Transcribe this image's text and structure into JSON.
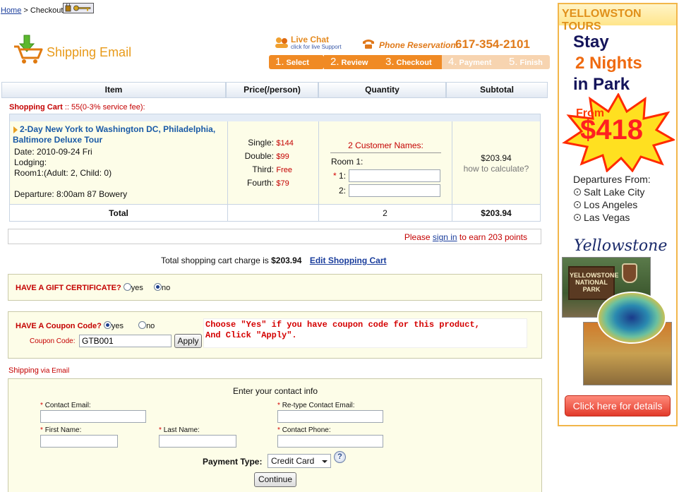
{
  "breadcrumb": {
    "home": "Home",
    "sep": ">",
    "current": "Checkout"
  },
  "header": {
    "logo_text": "Shipping Email",
    "live_chat": "Live Chat",
    "live_chat_sub": "click for live Support",
    "phone_label": "Phone Reservation:",
    "phone_number": "617-354-2101",
    "steps": [
      {
        "num": "1.",
        "label": "Select"
      },
      {
        "num": "2.",
        "label": "Review"
      },
      {
        "num": "3.",
        "label": "Checkout"
      },
      {
        "num": "4.",
        "label": "Payment"
      },
      {
        "num": "5.",
        "label": "Finish"
      }
    ]
  },
  "table": {
    "headers": [
      "Item",
      "Price(/person)",
      "Quantity",
      "Subtotal"
    ],
    "cart_label": "Shopping Cart",
    "cart_fee": " :: 55(0-3% service fee):",
    "tour_title": "2-Day New York to Washington DC, Philadelphia, Baltimore Deluxe Tour",
    "date": "Date: 2010-09-24 Fri",
    "lodging": "Lodging:",
    "room": "Room1:(Adult: 2, Child: 0)",
    "departure": "Departure: 8:00am 87 Bowery",
    "prices": [
      {
        "label": "Single:",
        "value": "$144"
      },
      {
        "label": "Double:",
        "value": "$99"
      },
      {
        "label": "Third:",
        "value": "Free"
      },
      {
        "label": "Fourth:",
        "value": "$79"
      }
    ],
    "customer_names": "2 Customer Names:",
    "room1": "Room 1:",
    "name1_label": "1:",
    "name2_label": "2:",
    "subtotal": "$203.94",
    "how_calc": "how to calculate?",
    "total_label": "Total",
    "total_qty": "2",
    "total_value": "$203.94"
  },
  "points": {
    "please": "Please ",
    "sign_in": "sign in",
    "rest": " to earn 203 points"
  },
  "charge": {
    "text": "Total shopping cart charge is ",
    "amount": "$203.94",
    "edit": "Edit Shopping Cart"
  },
  "gift": {
    "label": "HAVE A GIFT CERTIFICATE?",
    "yes": "yes",
    "no": "no"
  },
  "coupon": {
    "label": "HAVE A Coupon Code?",
    "yes": "yes",
    "no": "no",
    "code_label": "Coupon Code:",
    "code_value": "GTB001",
    "apply": "Apply",
    "hint1": "Choose \"Yes\" if you have coupon code for this product,",
    "hint2": "And Click \"Apply\"."
  },
  "shipping": {
    "title": "Shipping",
    "via": " via Email",
    "contact_info": "Enter your contact info",
    "email_label": "Contact Email:",
    "retype_label": "Re-type Contact Email:",
    "first_label": "First Name:",
    "last_label": "Last Name:",
    "phone_label": "Contact Phone:",
    "payment_label": "Payment Type:",
    "payment_value": "Credit Card",
    "continue": "Continue"
  },
  "ad": {
    "brand": "YELLOWSTON TOURS",
    "stay": "Stay",
    "nights": "2 Nights",
    "in_park": "in Park",
    "from": "From",
    "price": "$418",
    "departures": "Departures From:",
    "cities": [
      "Salt Lake City",
      "Los Angeles",
      "Las Vegas"
    ],
    "script": "Yellowstone",
    "sign": "YELLOWSTONE NATIONAL PARK",
    "cta": "Click here for details"
  }
}
